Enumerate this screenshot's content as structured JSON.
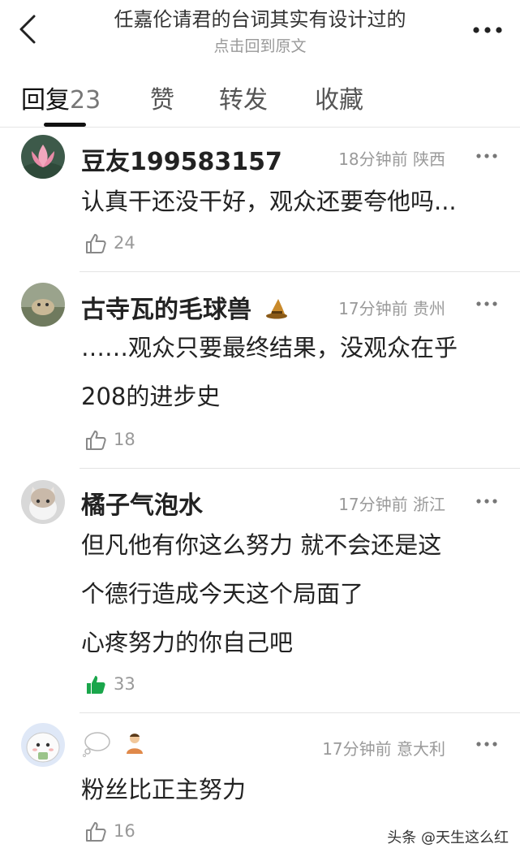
{
  "header": {
    "title": "任嘉伦请君的台词其实有设计过的",
    "subtitle": "点击回到原文"
  },
  "tabs": {
    "reply_label": "回复",
    "reply_count": "23",
    "like_label": "赞",
    "forward_label": "转发",
    "favorite_label": "收藏"
  },
  "comments": [
    {
      "name": "豆友199583157",
      "meta": "18分钟前 陕西",
      "lines": [
        "认真干还没干好，观众还要夸他吗..."
      ],
      "likes": "24",
      "liked": false
    },
    {
      "name": "古寺瓦的毛球兽",
      "badge": "wizard-hat-badge",
      "meta": "17分钟前 贵州",
      "lines": [
        "……观众只要最终结果，没观众在乎",
        "208的进步史"
      ],
      "likes": "18",
      "liked": false
    },
    {
      "name": "橘子气泡水",
      "meta": "17分钟前 浙江",
      "lines": [
        "但凡他有你这么努力 就不会还是这",
        "个德行造成今天这个局面了",
        "心疼努力的你自己吧"
      ],
      "likes": "33",
      "liked": true
    },
    {
      "name": "",
      "badge": "thought-bubble-and-figure",
      "meta": "17分钟前 意大利",
      "lines": [
        "粉丝比正主努力"
      ],
      "likes": "16",
      "liked": false
    }
  ],
  "watermark": "头条 @天生这么红",
  "colors": {
    "liked_green": "#1aa64b",
    "muted": "#999999"
  }
}
